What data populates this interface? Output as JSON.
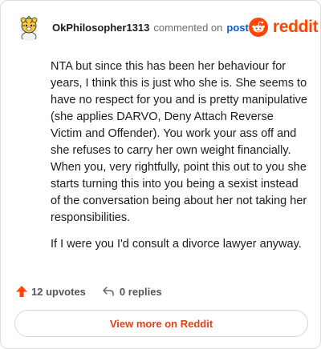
{
  "header": {
    "username": "OkPhilosopher1313",
    "action_text": "commented on",
    "post_link": "post",
    "brand_text": "reddit",
    "brand_color": "#ff4500"
  },
  "comment": {
    "paragraphs": [
      "NTA but since this has been her behaviour for years, I think this is just who she is. She seems to have no respect for you and is pretty manipulative (she applies DARVO, Deny Attach Reverse Victim and Offender). You work your ass off and she refuses to carry her own weight financially. When you, very rightfully, point this out to you she starts turning this into you being a sexist instead of the conversation being about her not taking her responsibilities.",
      "If I were you I'd consult a divorce lawyer anyway."
    ]
  },
  "footer": {
    "upvotes": "12 upvotes",
    "replies": "0 replies",
    "upvote_icon": "upvote-arrow-icon",
    "reply_icon": "reply-arrow-icon"
  },
  "cta": {
    "label": "View more on Reddit"
  }
}
